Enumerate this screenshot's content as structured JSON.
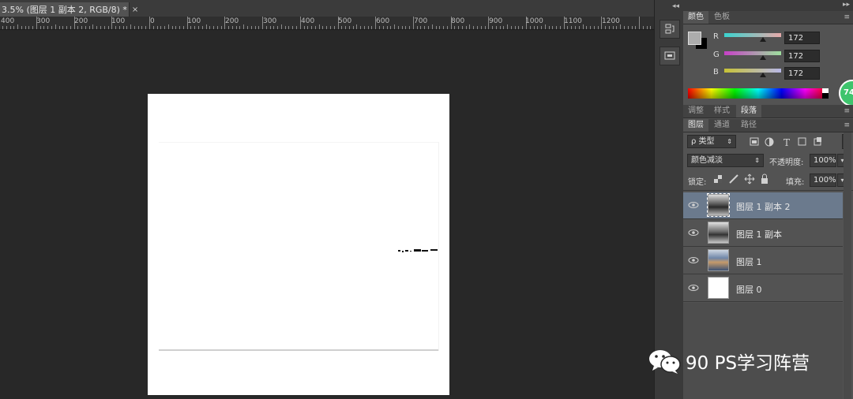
{
  "document": {
    "tab_title": "3.5% (图层 1 副本 2, RGB/8) *",
    "close_glyph": "×"
  },
  "ruler": {
    "labels": [
      "400",
      "300",
      "200",
      "100",
      "0",
      "100",
      "200",
      "300",
      "400",
      "500",
      "600",
      "700",
      "800",
      "900",
      "1000",
      "1100",
      "1200"
    ]
  },
  "color_panel": {
    "tabs": [
      {
        "label": "颜色",
        "active": true
      },
      {
        "label": "色板",
        "active": false
      }
    ],
    "channels": [
      {
        "label": "R",
        "value": "172",
        "fraction": 0.674
      },
      {
        "label": "G",
        "value": "172",
        "fraction": 0.674
      },
      {
        "label": "B",
        "value": "172",
        "fraction": 0.674
      }
    ],
    "foreground": "#acacac",
    "background": "#000000"
  },
  "adjust_panel": {
    "tabs": [
      {
        "label": "调整",
        "active": false
      },
      {
        "label": "样式",
        "active": false
      },
      {
        "label": "段落",
        "active": true
      }
    ]
  },
  "layers_panel": {
    "tabs": [
      {
        "label": "图层",
        "active": true
      },
      {
        "label": "通道",
        "active": false
      },
      {
        "label": "路径",
        "active": false
      }
    ],
    "filter_label": "ρ 类型",
    "blend_mode": "颜色减淡",
    "opacity_label": "不透明度:",
    "opacity_value": "100%",
    "lock_label": "锁定:",
    "fill_label": "填充:",
    "fill_value": "100%",
    "layers": [
      {
        "name": "图层 1 副本 2",
        "selected": true
      },
      {
        "name": "图层 1 副本",
        "selected": false
      },
      {
        "name": "图层 1",
        "selected": false
      },
      {
        "name": "图层 0",
        "selected": false
      }
    ]
  },
  "badge": {
    "text": "74"
  },
  "watermark": {
    "text": "90 PS学习阵营"
  },
  "icons": [
    "history-icon",
    "properties-icon",
    "eye-icon",
    "lock-transparent-icon",
    "lock-paint-icon",
    "lock-move-icon",
    "lock-all-icon",
    "wechat-icon"
  ]
}
